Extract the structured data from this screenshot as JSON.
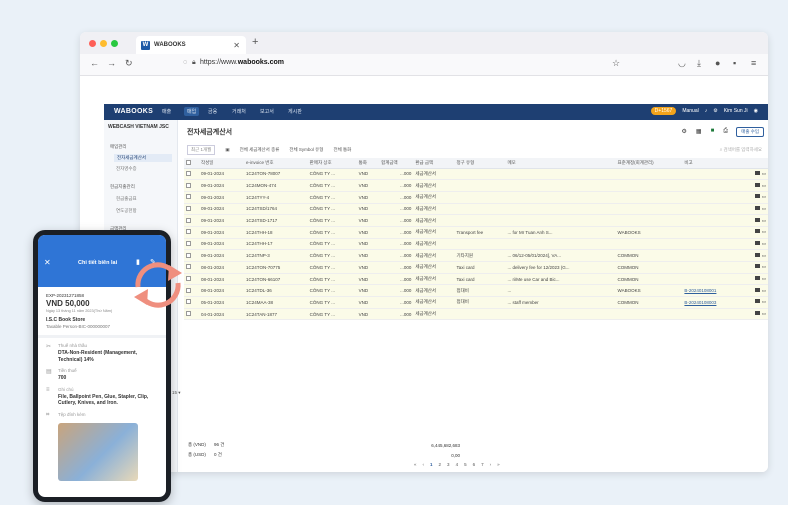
{
  "browser": {
    "tab_title": "WABOOKS",
    "tab_logo": "W",
    "url_prefix": "https://www.",
    "url_domain": "wabooks.com"
  },
  "app": {
    "logo": "WABOOKS",
    "menu": [
      "매출",
      "매입",
      "금융",
      "거래처",
      "보고서",
      "게시판"
    ],
    "active_menu_index": 1,
    "badge": "D+1567",
    "manual": "Manual",
    "user": "Kim Sun Ji",
    "company": "WEBCASH VIETNAM JSC",
    "sidebar": [
      {
        "label": "매입관리",
        "type": "group"
      },
      {
        "label": "전자세금계산서",
        "type": "sel"
      },
      {
        "label": "전자영수증",
        "type": "sub"
      },
      {
        "label": "현금지출관리",
        "type": "group"
      },
      {
        "label": "현금출금표",
        "type": "sub"
      },
      {
        "label": "연도공헌항",
        "type": "sub"
      },
      {
        "label": "금액관리",
        "type": "group"
      }
    ],
    "page_title": "전자세금계산서",
    "filters": [
      "최근 1개월",
      "전체 세금계산서 종류",
      "전체 Symbol 유형",
      "전체 통화"
    ],
    "search_placeholder": "검색어를 입력하세요",
    "excel_button": "매출 수입",
    "columns": [
      "작성일",
      "e-invoice 번호",
      "판매자 상호",
      "통화",
      "합계금액",
      "환급 금액",
      "청구 유형",
      "메모",
      "표준계정(회계관리)",
      "비고"
    ],
    "rows": [
      [
        "09-01-2024",
        "1C24TON-78007",
        "CÔNG TY ...",
        "VND",
        "...000",
        "세금계산서",
        "",
        "",
        "",
        ""
      ],
      [
        "09-01-2024",
        "1C24MON-474",
        "CÔNG TY ...",
        "VND",
        "...000",
        "세금계산서",
        "",
        "",
        "",
        ""
      ],
      [
        "09-01-2024",
        "1C24TYY-4",
        "CÔNG TY ...",
        "VND",
        "...000",
        "세금계산서",
        "",
        "",
        "",
        ""
      ],
      [
        "09-01-2024",
        "1C24TSD/1764",
        "CÔNG TY ...",
        "VND",
        "...000",
        "세금계산서",
        "",
        "",
        "",
        ""
      ],
      [
        "09-01-2024",
        "1C24TSD-1717",
        "CÔNG TY ...",
        "VND",
        "...000",
        "세금계산서",
        "",
        "",
        "",
        ""
      ],
      [
        "09-01-2024",
        "1C24THH-18",
        "CÔNG TY ...",
        "VND",
        "...000",
        "세금계산서",
        "Transport fee",
        "... for Mr Tuan Anh S...",
        "WABOOKS",
        ""
      ],
      [
        "09-01-2024",
        "1C24THH-17",
        "CÔNG TY ...",
        "VND",
        "...000",
        "세금계산서",
        "",
        "",
        "",
        ""
      ],
      [
        "09-01-2024",
        "1C24TNP-3",
        "CÔNG TY ...",
        "VND",
        "...000",
        "세금계산서",
        "기타지원",
        "... 06/12-05/01/2024], VA...",
        "COMMON",
        ""
      ],
      [
        "08-01-2024",
        "1C24TON-70775",
        "CÔNG TY ...",
        "VND",
        "...000",
        "세금계산서",
        "Taxi card",
        "... delivery fee for 12/2023 (G...",
        "COMMON",
        ""
      ],
      [
        "08-01-2024",
        "1C24TON-66107",
        "CÔNG TY ...",
        "VND",
        "...000",
        "세금계산서",
        "Taxi card",
        "... ri/Me use Car and Bic...",
        "COMMON",
        ""
      ],
      [
        "08-01-2024",
        "1C24TDL-36",
        "CÔNG TY ...",
        "VND",
        "...000",
        "세금계산서",
        "접대비",
        "...",
        "WABOOKS",
        "B-20240108001"
      ],
      [
        "05-01-2024",
        "1C24MAA-38",
        "CÔNG TY ...",
        "VND",
        "...000",
        "세금계산서",
        "접대비",
        "... staff member",
        "COMMON",
        "B-20240108003"
      ],
      [
        "04-01-2024",
        "1C24TAN-1877",
        "CÔNG TY ...",
        "VND",
        "...000",
        "세금계산서",
        "",
        "",
        "",
        ""
      ]
    ],
    "totals": [
      {
        "label": "총 (VND)",
        "count": "96 건",
        "amount": "6,445,682,683"
      },
      {
        "label": "총 (USD)",
        "count": "0 건",
        "amount": "0,00"
      }
    ],
    "page_size": "15",
    "pages": [
      "1",
      "2",
      "3",
      "4",
      "5",
      "6",
      "7"
    ]
  },
  "phone": {
    "title": "Chi tiết biên lai",
    "id": "EXP-20231271858",
    "amount": "VND 50,000",
    "date": "Ngày 13 tháng 11 năm 2023(Thứ Năm)",
    "vendor": "I.S.C Book Store",
    "tax_id": "Taxable Person-BIC-000000007",
    "fields": [
      {
        "label": "Thuế nhà thầu",
        "value": "DTA-Non-Resident (Management, Technical) 14%"
      },
      {
        "label": "Tiền thuế",
        "value": "700"
      },
      {
        "label": "Ghi chú",
        "value": "File, Ballpoint Pen, Glue, Stapler, Clip, Cutlery, Knives, and Iron."
      },
      {
        "label": "Tệp đính kèm",
        "value": ""
      }
    ]
  },
  "colors": {
    "nav": "#1e3f72",
    "phone_header": "#2f75d6",
    "arrows": "#ef8f7f",
    "row_highlight": "#fbfbe8"
  }
}
